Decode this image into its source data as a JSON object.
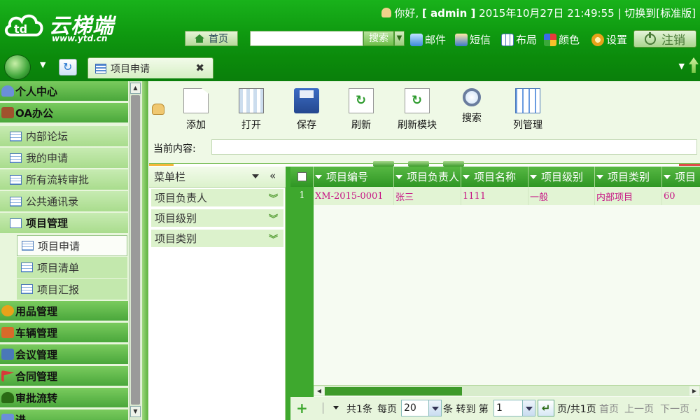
{
  "header": {
    "logo": {
      "name": "云梯端",
      "url": "www.ytd.cn"
    },
    "user": {
      "greeting": "你好,",
      "username": "[ admin ]",
      "datetime": "2015年10月27日 21:49:55",
      "separator": "|",
      "switch_label": "切换到[标准版]"
    },
    "home_label": "首页",
    "search": {
      "placeholder": "",
      "button_label": "搜索"
    },
    "links": {
      "mail": "邮件",
      "sms": "短信",
      "layout": "布局",
      "color": "颜色",
      "settings": "设置"
    },
    "logout_label": "注销"
  },
  "tabs": {
    "active_tab": "项目申请",
    "close_glyph": "✖"
  },
  "sidebar": {
    "groups": {
      "personal": "个人中心",
      "oa": "OA办公",
      "supplies": "用品管理",
      "vehicles": "车辆管理",
      "meetings": "会议管理",
      "contracts": "合同管理",
      "approval": "审批流转",
      "more": "进"
    },
    "oa_items": {
      "forum": "内部论坛",
      "my_requests": "我的申请",
      "all_approvals": "所有流转审批",
      "contacts": "公共通讯录",
      "project_mgmt": "项目管理"
    },
    "project_items": {
      "apply": "项目申请",
      "list": "项目清单",
      "summary": "项目汇报"
    }
  },
  "toolbar": {
    "add": "添加",
    "open": "打开",
    "save": "保存",
    "refresh": "刷新",
    "refresh_module": "刷新模块",
    "search": "搜索",
    "columns": "列管理",
    "current_label": "当前内容:",
    "current_value": ""
  },
  "filter_panel": {
    "title": "菜单栏",
    "collapse_glyph": "«",
    "expand_glyph": "»",
    "items": {
      "owner": "项目负责人",
      "level": "项目级别",
      "type": "项目类别"
    }
  },
  "grid": {
    "columns": {
      "code": "项目编号",
      "owner": "项目负责人",
      "name": "项目名称",
      "level": "项目级别",
      "type": "项目类别",
      "period": "项目"
    },
    "rows": [
      {
        "rownum": "1",
        "code": "XM-2015-0001",
        "owner": "张三",
        "name": "1111",
        "level": "一般",
        "type": "内部项目",
        "period": "60"
      }
    ]
  },
  "pager": {
    "add_glyph": "+",
    "total": "共1条",
    "per_page_label": "每页",
    "per_page_value": "20",
    "goto_label": "条 转到 第",
    "page_value": "1",
    "go_glyph": "↵",
    "page_info": "页/共1页",
    "first": "首页",
    "prev": "上一页",
    "next": "下一页",
    "trailing": ","
  },
  "colors": {
    "header_green": "#0f9a10",
    "grid_header_green": "#3ea82e",
    "row_text_magenta": "#c71585",
    "sidebar_bg": "#e8f6dc"
  }
}
